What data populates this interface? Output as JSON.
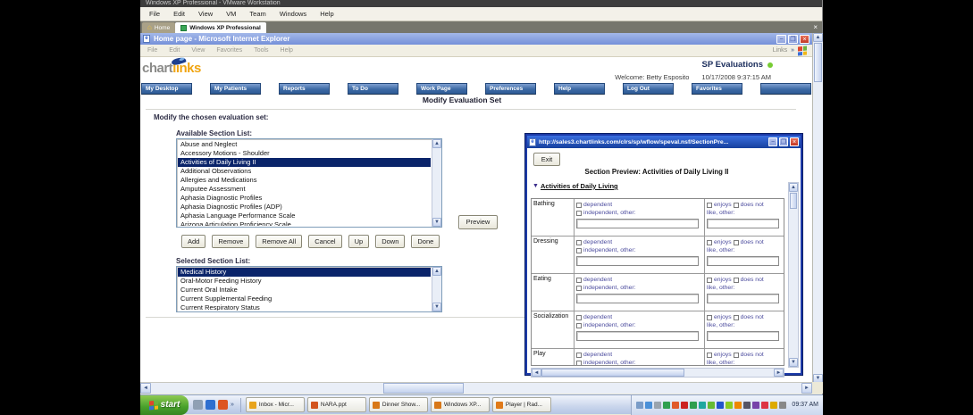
{
  "icons": {
    "up": "▲",
    "down": "▼",
    "left": "◄",
    "right": "►",
    "close": "×",
    "minimize": "−",
    "restore": "❐",
    "chevron_overflow": "»",
    "home": "⌂",
    "ie_doc": "e"
  },
  "vmware": {
    "title": "Windows XP Professional - VMware Workstation",
    "menu": [
      "File",
      "Edit",
      "View",
      "VM",
      "Team",
      "Windows",
      "Help"
    ],
    "tab_home": "Home",
    "tab_active": "Windows XP Professional"
  },
  "ie": {
    "title": "Home page - Microsoft Internet Explorer",
    "menu": [
      "File",
      "Edit",
      "View",
      "Favorites",
      "Tools",
      "Help"
    ],
    "links_label": "Links"
  },
  "app": {
    "brand_part1": "chart",
    "brand_part2": "links",
    "module_title": "SP Evaluations",
    "welcome": "Welcome: Betty Esposito",
    "datetime": "10/17/2008 9:37:15 AM",
    "nav": [
      "My Desktop",
      "My Patients",
      "Reports",
      "To Do",
      "Work Page",
      "Preferences",
      "Help",
      "Log Out",
      "Favorites",
      ""
    ],
    "page_heading": "Modify Evaluation Set",
    "subheading": "Modify the chosen evaluation set:",
    "available_label": "Available Section List:",
    "available_items": [
      "Abuse and Neglect",
      "Accessory Motions - Shoulder",
      "Activities of Daily Living II",
      "Additional Observations",
      "Allergies and Medications",
      "Amputee Assessment",
      "Aphasia Diagnostic Profiles",
      "Aphasia Diagnostic Profiles (ADP)",
      "Aphasia Language Performance Scale",
      "Arizona Articulation Proficiency Scale"
    ],
    "available_selected_index": 2,
    "preview_button": "Preview",
    "action_buttons": [
      "Add",
      "Remove",
      "Remove All",
      "Cancel",
      "Up",
      "Down",
      "Done"
    ],
    "selected_label": "Selected Section List:",
    "selected_items": [
      "Medical History",
      "Oral-Motor Feeding History",
      "Current Oral Intake",
      "Current Supplemental Feeding",
      "Current Respiratory Status"
    ],
    "selected_selected_index": 0
  },
  "popup": {
    "url_title": "http://sales3.chartlinks.com/clrs/sp/wflow/speval.nsf/SectionPre...",
    "exit_button": "Exit",
    "heading": "Section Preview: Activities of Daily Living II",
    "section_link": "Activities of Daily Living",
    "rows": [
      "Bathing",
      "Dressing",
      "Eating",
      "Socialization",
      "Play"
    ],
    "col_mid": {
      "cb1": "dependent",
      "cb2": "independent, other:"
    },
    "col_right": {
      "cb1": "enjoys",
      "cb2": "does not",
      "cont": "like, other:"
    }
  },
  "taskbar": {
    "start_label": "start",
    "quicklaunch_colors": [
      "#8fa0b4",
      "#2f6fd0",
      "#dd5522"
    ],
    "buttons": [
      {
        "label": "Inbox - Micr...",
        "color": "#e8a41c"
      },
      {
        "label": "NARA.ppt",
        "color": "#d2541e"
      },
      {
        "label": "Dinner Show...",
        "color": "#d87818"
      },
      {
        "label": "Windows XP...",
        "color": "#d87818"
      },
      {
        "label": "Player | Rad...",
        "color": "#e07a1a"
      }
    ],
    "tray_icon_colors": [
      "#7a9cc8",
      "#4a90d8",
      "#9aa4ae",
      "#30a050",
      "#e05a2b",
      "#cc2222",
      "#2e9e4f",
      "#1fa7a0",
      "#66bb33",
      "#2255cc",
      "#88cc22",
      "#ee8800",
      "#555566",
      "#7744aa",
      "#dd3344",
      "#ddaa00",
      "#888888"
    ],
    "clock": "09:37 AM"
  },
  "colors": {
    "accent_blue": "#2d5a96",
    "selection": "#0a246a",
    "popup_border": "#1c3aa8",
    "start_green": "#47a02b",
    "brand_orange": "#f0a512"
  }
}
